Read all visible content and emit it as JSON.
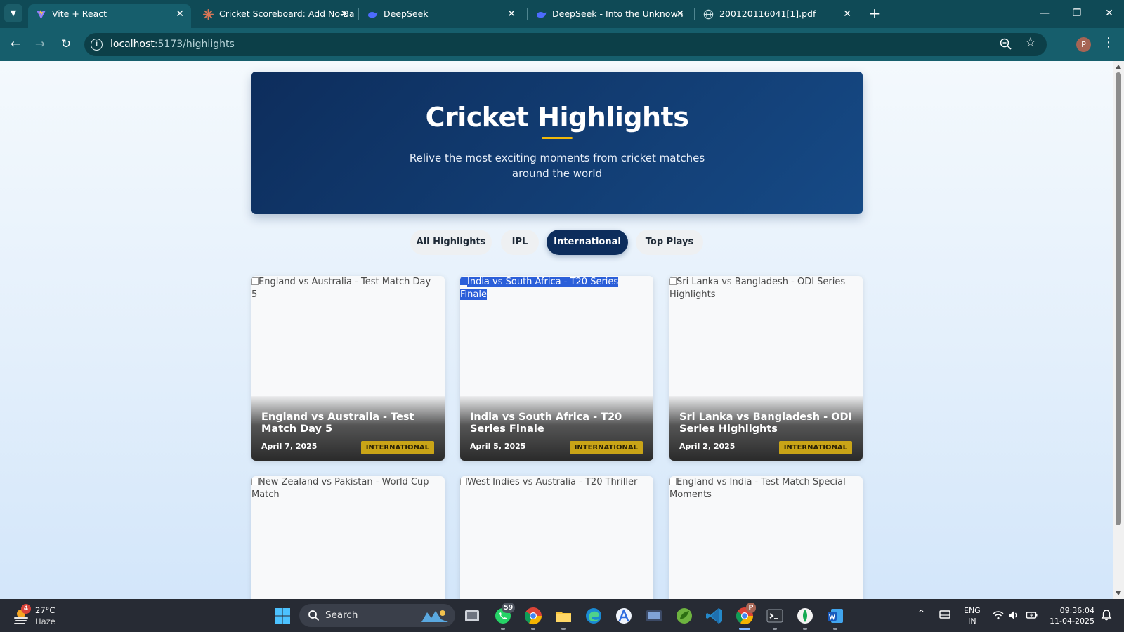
{
  "browser": {
    "tabs": [
      {
        "title": "Vite + React",
        "active": true
      },
      {
        "title": "Cricket Scoreboard: Add No-Ba",
        "active": false
      },
      {
        "title": "DeepSeek",
        "active": false
      },
      {
        "title": "DeepSeek - Into the Unknown",
        "active": false
      },
      {
        "title": "200120116041[1].pdf",
        "active": false
      }
    ],
    "close_glyph": "✕",
    "new_tab_glyph": "+",
    "window_controls": {
      "minimize": "—",
      "restore": "❐",
      "close": "✕"
    },
    "url_host": "localhost",
    "url_path": ":5173/highlights",
    "profile_initial": "P",
    "menu_glyph": "⋮",
    "nav": {
      "back": "←",
      "forward": "→",
      "reload": "↻"
    }
  },
  "hero": {
    "title": "Cricket Highlights",
    "subtitle": "Relive the most exciting moments from cricket matches around the world"
  },
  "filters": [
    {
      "label": "All Highlights",
      "active": false
    },
    {
      "label": "IPL",
      "active": false
    },
    {
      "label": "International",
      "active": true
    },
    {
      "label": "Top Plays",
      "active": false
    }
  ],
  "cards": [
    {
      "alt": "England vs Australia - Test Match Day 5",
      "title": "England vs Australia - Test Match Day 5",
      "date": "April 7, 2025",
      "badge": "INTERNATIONAL",
      "selected": false
    },
    {
      "alt": "India vs South Africa - T20 Series Finale",
      "title": "India vs South Africa - T20 Series Finale",
      "date": "April 5, 2025",
      "badge": "INTERNATIONAL",
      "selected": true
    },
    {
      "alt": "Sri Lanka vs Bangladesh - ODI Series Highlights",
      "title": "Sri Lanka vs Bangladesh - ODI Series Highlights",
      "date": "April 2, 2025",
      "badge": "INTERNATIONAL",
      "selected": false
    },
    {
      "alt": "New Zealand vs Pakistan - World Cup Match",
      "selected": false
    },
    {
      "alt": "West Indies vs Australia - T20 Thriller",
      "selected": false
    },
    {
      "alt": "England vs India - Test Match Special Moments",
      "selected": false
    }
  ],
  "taskbar": {
    "weather_temp": "27°C",
    "weather_desc": "Haze",
    "weather_badge": "4",
    "search_label": "Search",
    "whatsapp_badge": "59",
    "chrome_badge": "P",
    "lang_line1": "ENG",
    "lang_line2": "IN",
    "time": "09:36:04",
    "date": "11-04-2025",
    "tray_chevron": "^"
  },
  "colors": {
    "browser_frame": "#0f4a56",
    "hero_bg": "#0d2d5c",
    "accent_gold": "#f0b90b",
    "badge_gold": "#c9a417"
  }
}
